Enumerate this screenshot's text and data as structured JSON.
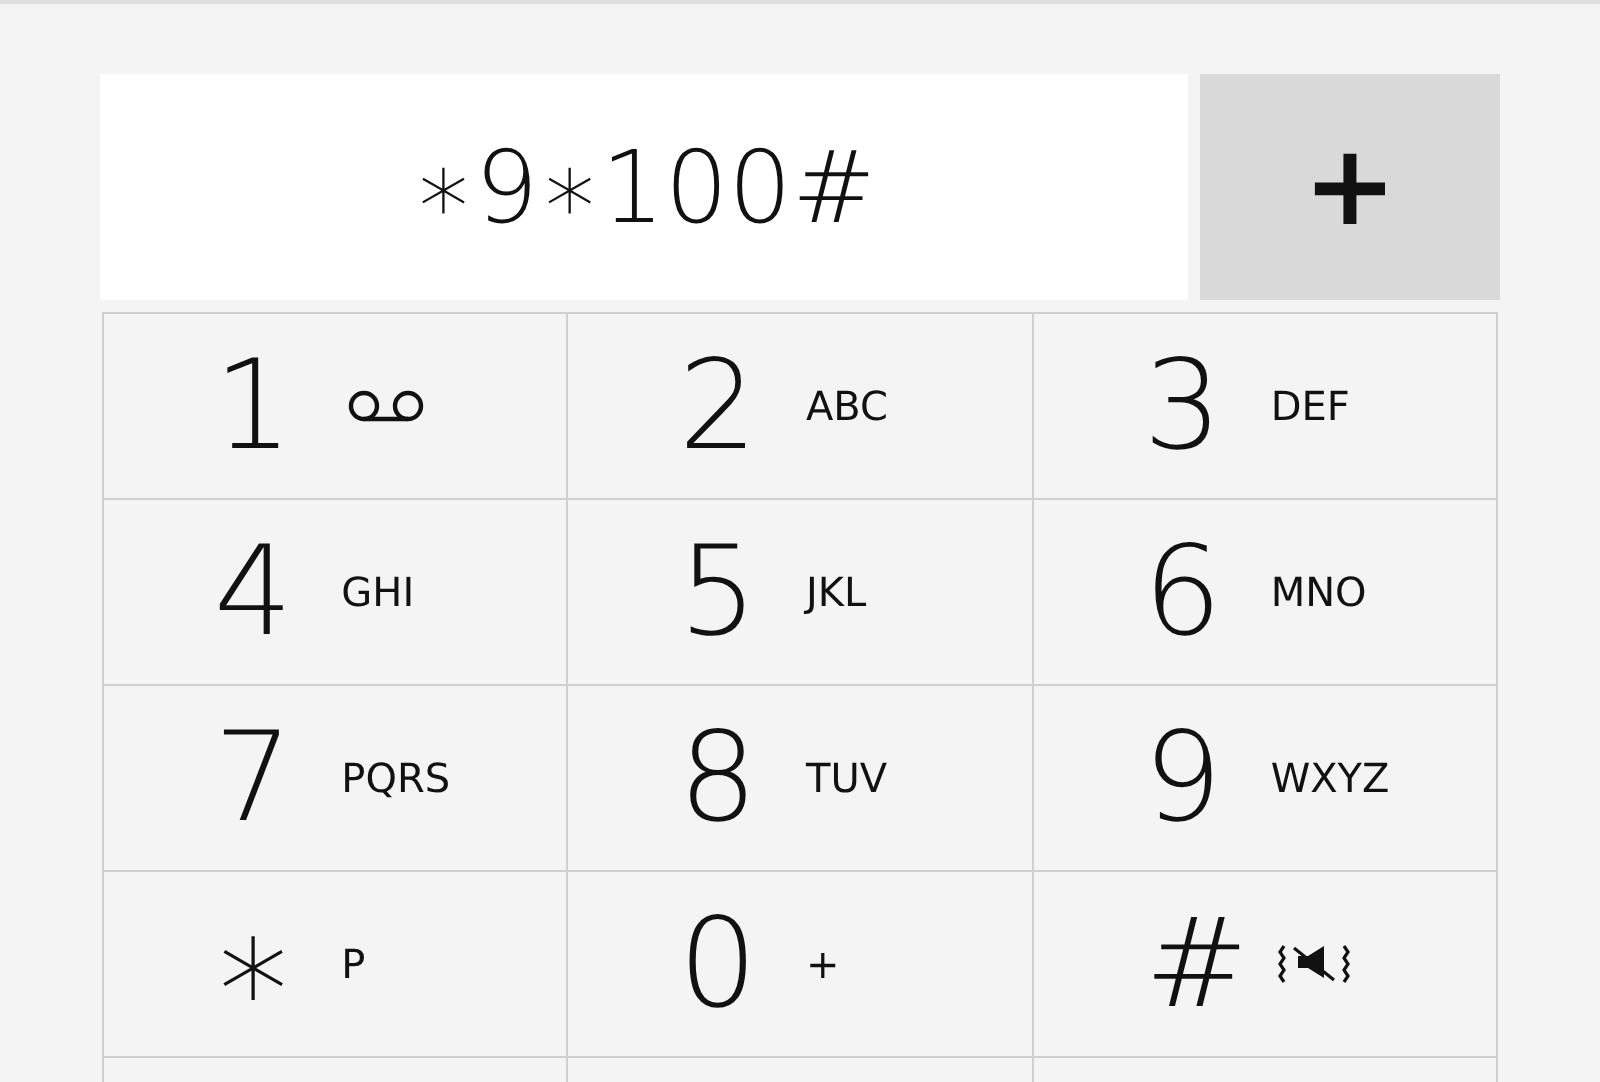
{
  "display": {
    "value": "∗9∗100#"
  },
  "add_button": {
    "label": "+"
  },
  "keys": [
    {
      "digit": "1",
      "kind": "voicemail"
    },
    {
      "digit": "2",
      "kind": "letters",
      "letters": "ABC"
    },
    {
      "digit": "3",
      "kind": "letters",
      "letters": "DEF"
    },
    {
      "digit": "4",
      "kind": "letters",
      "letters": "GHI"
    },
    {
      "digit": "5",
      "kind": "letters",
      "letters": "JKL"
    },
    {
      "digit": "6",
      "kind": "letters",
      "letters": "MNO"
    },
    {
      "digit": "7",
      "kind": "letters",
      "letters": "PQRS"
    },
    {
      "digit": "8",
      "kind": "letters",
      "letters": "TUV"
    },
    {
      "digit": "9",
      "kind": "letters",
      "letters": "WXYZ"
    },
    {
      "digit": "∗",
      "kind": "letters",
      "letters": "P"
    },
    {
      "digit": "0",
      "kind": "letters",
      "letters": "+"
    },
    {
      "digit": "#",
      "kind": "mute"
    }
  ]
}
